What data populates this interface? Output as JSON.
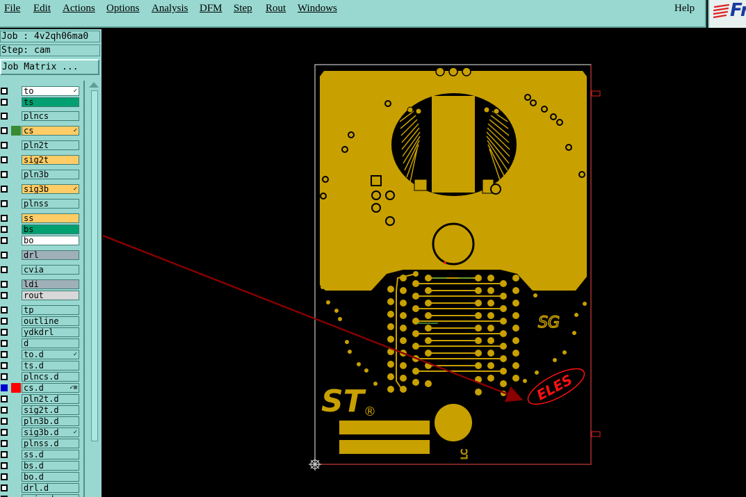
{
  "menu": {
    "items": [
      "File",
      "Edit",
      "Actions",
      "Options",
      "Analysis",
      "DFM",
      "Step",
      "Rout",
      "Windows"
    ],
    "help": "Help"
  },
  "logo": {
    "text": "Fr",
    "icon": "frontline-logo-icon"
  },
  "panel": {
    "job": "Job : 4v2qh06ma0",
    "step": "Step: cam",
    "job_matrix_button": "Job Matrix ..."
  },
  "colors": {
    "panel": "#98d8d0",
    "signal_layer": "#ffcc66",
    "board_copper": "#c8a000",
    "green_layer": "#00a070",
    "grey_layer": "#a0b0b8",
    "arrow": "#8b0000"
  },
  "layers": [
    {
      "name": "to",
      "bg": "#ffffff",
      "mark": "✓"
    },
    {
      "name": "ts",
      "bg": "#00a070",
      "mark": ""
    },
    {
      "name": "plncs",
      "bg": "#98d8d0",
      "mark": ""
    },
    {
      "name": "cs",
      "bg": "#ffcc66",
      "mark": "✓",
      "swatch": "#3a8a30"
    },
    {
      "name": "pln2t",
      "bg": "#98d8d0",
      "mark": ""
    },
    {
      "name": "sig2t",
      "bg": "#ffcc66",
      "mark": ""
    },
    {
      "name": "pln3b",
      "bg": "#98d8d0",
      "mark": ""
    },
    {
      "name": "sig3b",
      "bg": "#ffcc66",
      "mark": "✓"
    },
    {
      "name": "plnss",
      "bg": "#98d8d0",
      "mark": ""
    },
    {
      "name": "ss",
      "bg": "#ffcc66",
      "mark": ""
    },
    {
      "name": "bs",
      "bg": "#00a070",
      "mark": ""
    },
    {
      "name": "bo",
      "bg": "#ffffff",
      "mark": ""
    },
    {
      "name": "drl",
      "bg": "#a0b0b8",
      "mark": ""
    },
    {
      "name": "cvia",
      "bg": "#98d8d0",
      "mark": ""
    },
    {
      "name": "ldi",
      "bg": "#a0b0b8",
      "mark": ""
    },
    {
      "name": "rout",
      "bg": "#d8d8d8",
      "mark": ""
    },
    {
      "name": "tp",
      "bg": "#98d8d0",
      "mark": ""
    },
    {
      "name": "outline",
      "bg": "#98d8d0",
      "mark": ""
    },
    {
      "name": "ydkdrl",
      "bg": "#98d8d0",
      "mark": ""
    },
    {
      "name": "d",
      "bg": "#98d8d0",
      "mark": ""
    },
    {
      "name": "to.d",
      "bg": "#98d8d0",
      "mark": "✓"
    },
    {
      "name": "ts.d",
      "bg": "#98d8d0",
      "mark": ""
    },
    {
      "name": "plncs.d",
      "bg": "#98d8d0",
      "mark": ""
    },
    {
      "name": "cs.d",
      "bg": "#98d8d0",
      "mark": "✓⊞",
      "swatch": "#ff0000",
      "active": true
    },
    {
      "name": "pln2t.d",
      "bg": "#98d8d0",
      "mark": ""
    },
    {
      "name": "sig2t.d",
      "bg": "#98d8d0",
      "mark": ""
    },
    {
      "name": "pln3b.d",
      "bg": "#98d8d0",
      "mark": ""
    },
    {
      "name": "sig3b.d",
      "bg": "#98d8d0",
      "mark": "✓"
    },
    {
      "name": "plnss.d",
      "bg": "#98d8d0",
      "mark": ""
    },
    {
      "name": "ss.d",
      "bg": "#98d8d0",
      "mark": ""
    },
    {
      "name": "bs.d",
      "bg": "#98d8d0",
      "mark": ""
    },
    {
      "name": "bo.d",
      "bg": "#98d8d0",
      "mark": ""
    },
    {
      "name": "drl.d",
      "bg": "#98d8d0",
      "mark": ""
    },
    {
      "name": "cvia.d",
      "bg": "#98d8d0",
      "mark": ""
    }
  ],
  "board": {
    "silkscreen_logo": "ST",
    "registered": "®",
    "label_sg": "SG",
    "label_lc": "LC",
    "eles_logo": "ELES"
  }
}
